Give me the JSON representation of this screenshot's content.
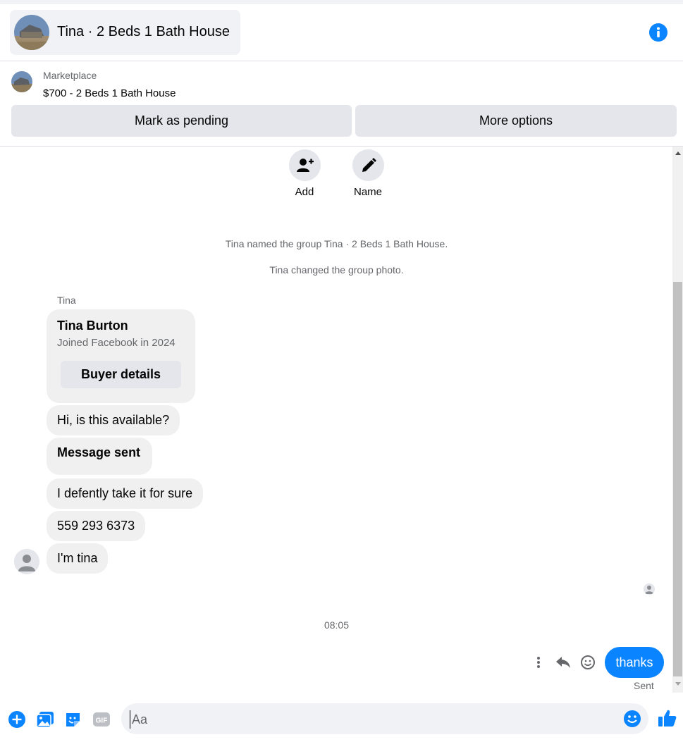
{
  "header": {
    "title": "Tina · 2 Beds 1 Bath House",
    "avatar_icon": "house-photo",
    "info_icon": "info-icon"
  },
  "marketplace": {
    "label": "Marketplace",
    "listing": "$700 - 2 Beds 1 Bath House",
    "mark_pending_label": "Mark as pending",
    "more_options_label": "More options"
  },
  "group_actions": {
    "add_label": "Add",
    "name_label": "Name"
  },
  "system_messages": [
    "Tina named the group Tina · 2 Beds 1 Bath House.",
    "Tina changed the group photo."
  ],
  "sender": "Tina",
  "buyer_card": {
    "name": "Tina Burton",
    "joined": "Joined Facebook in 2024",
    "button_label": "Buyer details"
  },
  "messages": [
    {
      "text": "Hi, is this available?",
      "bold": false
    },
    {
      "text": "Message sent",
      "bold": true
    },
    {
      "text": "I defently take it for sure",
      "bold": false
    },
    {
      "text": "559 293 6373",
      "bold": false
    },
    {
      "text": "I'm tina",
      "bold": false
    }
  ],
  "timestamp": "08:05",
  "outgoing": {
    "text": "thanks",
    "status": "Sent"
  },
  "composer": {
    "placeholder": "Aa",
    "value": ""
  },
  "colors": {
    "accent": "#0a84ff",
    "bubble_gray": "#f0f0f0",
    "button_gray": "#e4e6eb"
  }
}
